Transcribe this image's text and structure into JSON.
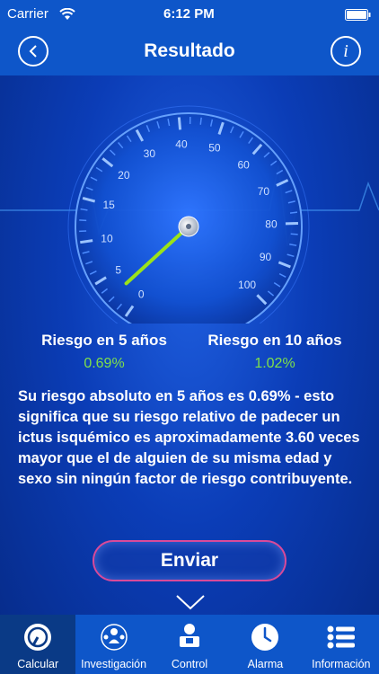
{
  "status": {
    "carrier": "Carrier",
    "time": "6:12 PM"
  },
  "nav": {
    "title": "Resultado"
  },
  "gauge": {
    "ticks": [
      "0",
      "5",
      "10",
      "15",
      "20",
      "30",
      "40",
      "50",
      "60",
      "70",
      "80",
      "90",
      "100"
    ],
    "needle_value": "0.69"
  },
  "risk": {
    "five": {
      "label": "Riesgo en 5 años",
      "value": "0.69%"
    },
    "ten": {
      "label": "Riesgo en 10 años",
      "value": "1.02%"
    }
  },
  "description": "Su riesgo absoluto en 5 años es 0.69% - esto significa que su riesgo relativo de padecer un ictus isquémico es aproximadamente 3.60 veces mayor que el de alguien de su misma edad y sexo sin ningún factor de riesgo contribuyente.",
  "send_label": "Enviar",
  "tabs": [
    {
      "label": "Calcular",
      "icon": "gauge-icon"
    },
    {
      "label": "Investigación",
      "icon": "research-icon"
    },
    {
      "label": "Control",
      "icon": "doctor-icon"
    },
    {
      "label": "Alarma",
      "icon": "clock-icon"
    },
    {
      "label": "Información",
      "icon": "list-icon"
    }
  ],
  "colors": {
    "bar": "#0e56c9",
    "active_tab": "#0a3a86",
    "green": "#7fe04a",
    "needle": "#9ae21a",
    "send_border": "#d84a9a"
  }
}
